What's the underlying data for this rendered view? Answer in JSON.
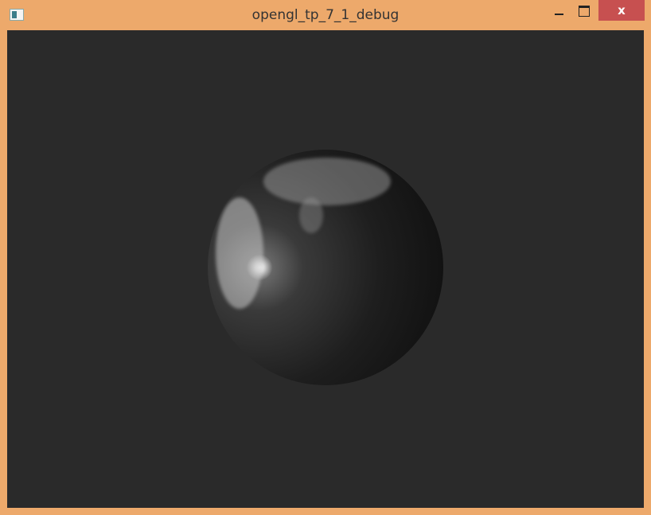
{
  "window": {
    "title": "opengl_tp_7_1_debug",
    "close_label": "x"
  }
}
